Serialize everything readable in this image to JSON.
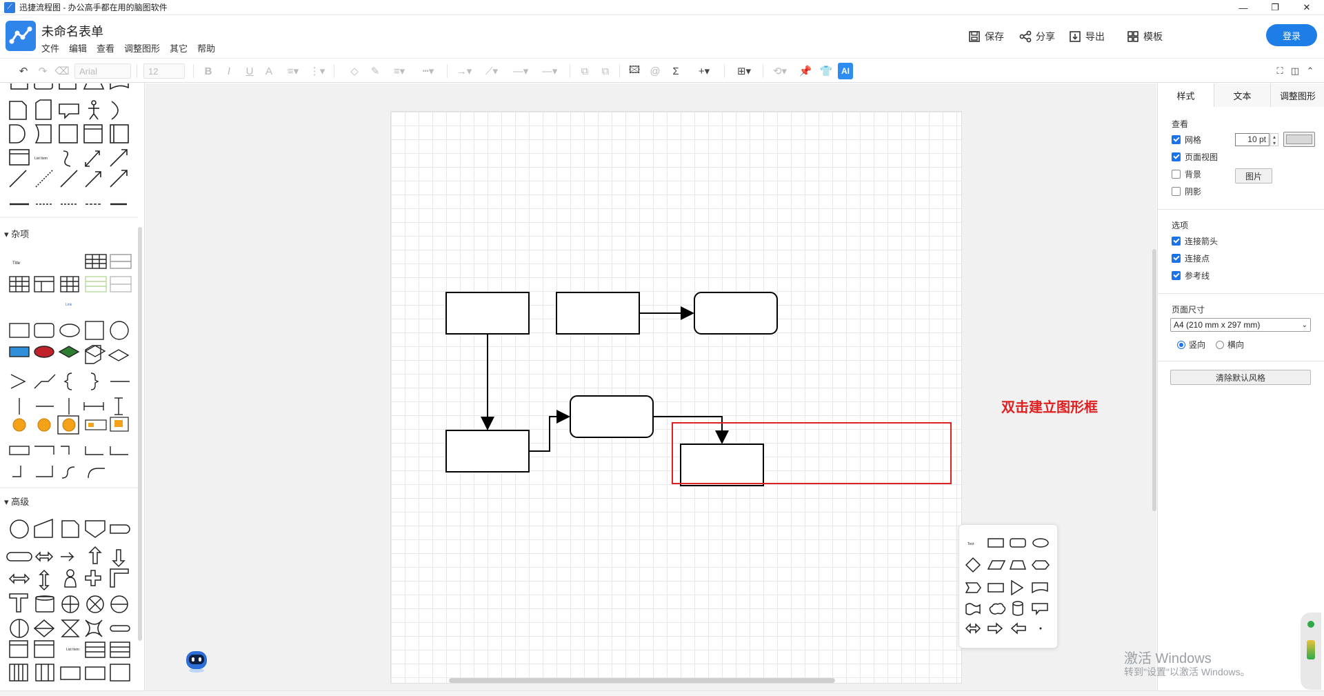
{
  "window": {
    "title": "迅捷流程图 - 办公高手都在用的脑图软件",
    "controls": [
      "—",
      "❐",
      "✕"
    ]
  },
  "header": {
    "doc_title": "未命名表单",
    "menu": [
      "文件",
      "编辑",
      "查看",
      "调整图形",
      "其它",
      "帮助"
    ],
    "actions": {
      "save": "保存",
      "share": "分享",
      "export": "导出",
      "template": "模板"
    },
    "login": "登录"
  },
  "toolbar": {
    "font_family": "Arial",
    "font_size": "12",
    "ai_label": "AI"
  },
  "left_panel": {
    "sections": [
      "杂项",
      "高级"
    ]
  },
  "canvas": {
    "annotation": "双击建立图形框",
    "watermark_line1": "激活 Windows",
    "watermark_line2": "转到\"设置\"以激活 Windows。"
  },
  "right_panel": {
    "tabs": [
      "样式",
      "文本",
      "调整图形"
    ],
    "view_section": "查看",
    "grid_label": "网格",
    "grid_size": "10 pt",
    "page_view_label": "页面视图",
    "background_label": "背景",
    "image_button": "图片",
    "shadow_label": "阴影",
    "options_section": "选项",
    "connect_arrows": "连接箭头",
    "connect_points": "连接点",
    "guides": "参考线",
    "page_size_section": "页面尺寸",
    "page_size_value": "A4 (210 mm x 297 mm)",
    "portrait": "竖向",
    "landscape": "横向",
    "clear_style_button": "清除默认风格",
    "checks": {
      "grid": true,
      "page_view": true,
      "background": false,
      "shadow": false,
      "connect_arrows": true,
      "connect_points": true,
      "guides": true
    },
    "orientation": "portrait"
  },
  "colors": {
    "accent": "#1e7ee8",
    "annotation_red": "#e02020"
  }
}
